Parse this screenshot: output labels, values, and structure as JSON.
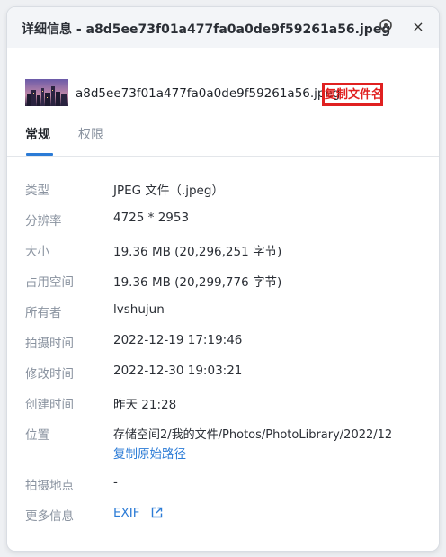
{
  "dialog": {
    "title": "详细信息 - a8d5ee73f01a477fa0a0de9f59261a56.jpeg",
    "close_symbol": "×"
  },
  "file": {
    "name": "a8d5ee73f01a477fa0a0de9f59261a56.jpeg",
    "copy_name_label": "复制文件名"
  },
  "tabs": [
    {
      "label": "常规",
      "active": true
    },
    {
      "label": "权限",
      "active": false
    }
  ],
  "properties": {
    "type": {
      "label": "类型",
      "value": "JPEG 文件（.jpeg）"
    },
    "resolution": {
      "label": "分辨率",
      "value": "4725 * 2953"
    },
    "size": {
      "label": "大小",
      "value": "19.36 MB (20,296,251 字节)"
    },
    "disk_size": {
      "label": "占用空间",
      "value": "19.36 MB (20,299,776 字节)"
    },
    "owner": {
      "label": "所有者",
      "value": "lvshujun"
    },
    "shot_time": {
      "label": "拍摄时间",
      "value": "2022-12-19 17:19:46"
    },
    "modified": {
      "label": "修改时间",
      "value": "2022-12-30 19:03:21"
    },
    "created": {
      "label": "创建时间",
      "value": "昨天 21:28"
    },
    "location": {
      "label": "位置",
      "value": "存储空间2/我的文件/Photos/PhotoLibrary/2022/12",
      "copy_path_label": "复制原始路径"
    },
    "shot_place": {
      "label": "拍摄地点",
      "value": "-"
    },
    "more": {
      "label": "更多信息",
      "value": "EXIF"
    }
  },
  "colors": {
    "accent": "#2b7bd6",
    "highlight": "#e02020",
    "label": "#8a93a0"
  }
}
